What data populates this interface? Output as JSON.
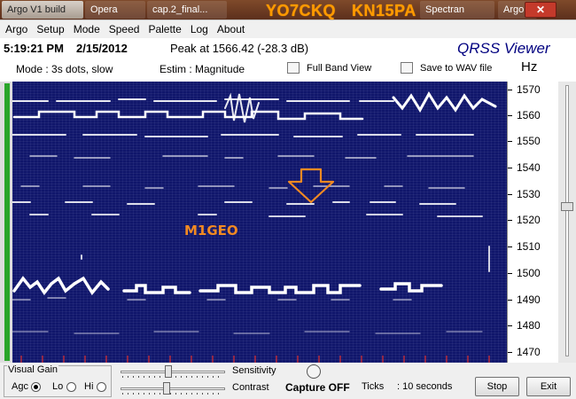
{
  "taskbar": {
    "items": [
      "Argo V1 build",
      "Opera",
      "cap.2_final...",
      "Spectran",
      "Argo"
    ],
    "overlay_call": "YO7CKQ",
    "overlay_locator": "KN15PA"
  },
  "menu": {
    "items": [
      "Argo",
      "Setup",
      "Mode",
      "Speed",
      "Palette",
      "Log",
      "About"
    ]
  },
  "status": {
    "time": "5:19:21 PM",
    "date": "2/15/2012",
    "peak": "Peak at 1566.42 (-28.3 dB)",
    "app_name": "QRSS Viewer",
    "mode": "Mode : 3s dots, slow",
    "estim": "Estim : Magnitude",
    "full_band_label": "Full Band View",
    "save_wav_label": "Save to WAV file",
    "unit": "Hz"
  },
  "spectrogram": {
    "station_label": "M1GEO",
    "colors": {
      "background": "#10166b",
      "signal": "#ffffff",
      "annotation": "#f28a22"
    }
  },
  "frequency_scale": {
    "labels": [
      "1570",
      "1560",
      "1550",
      "1540",
      "1530",
      "1520",
      "1510",
      "1500",
      "1490",
      "1480",
      "1470"
    ]
  },
  "controls": {
    "visual_gain_title": "Visual Gain",
    "agc_label": "Agc",
    "lo_label": "Lo",
    "hi_label": "Hi",
    "gain_selected": "Agc",
    "sensitivity_label": "Sensitivity",
    "contrast_label": "Contrast",
    "capture_label": "Capture OFF",
    "ticks_label": "Ticks",
    "ticks_value": ": 10 seconds",
    "stop_label": "Stop",
    "exit_label": "Exit"
  }
}
